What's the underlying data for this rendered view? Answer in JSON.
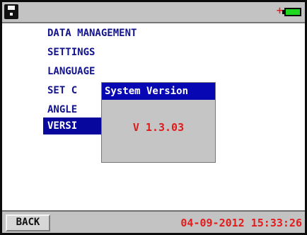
{
  "status_bar": {
    "sd_icon": "sd-card-icon",
    "battery_icon": "battery-charging-icon",
    "charging_symbol": "+",
    "battery_level": 0.8,
    "colors": {
      "charging": "#e21c1c",
      "battery_fill": "#1ed81e"
    }
  },
  "menu": {
    "items": [
      {
        "label": "DATA MANAGEMENT"
      },
      {
        "label": "SETTINGS"
      },
      {
        "label": "LANGUAGE"
      },
      {
        "label": "SET C"
      },
      {
        "label": "ANGLE"
      },
      {
        "label": "VERSI",
        "selected": true
      }
    ],
    "colors": {
      "text": "#13138c",
      "selected_bg": "#07079d",
      "selected_text": "#ffffff"
    }
  },
  "dialog": {
    "title": "System Version",
    "version": "V 1.3.03",
    "colors": {
      "title_bg": "#0707b4",
      "value": "#e01b1b",
      "background": "#c5c5c5"
    }
  },
  "footer": {
    "back_label": "BACK",
    "datetime": "04-09-2012 15:33:26"
  }
}
